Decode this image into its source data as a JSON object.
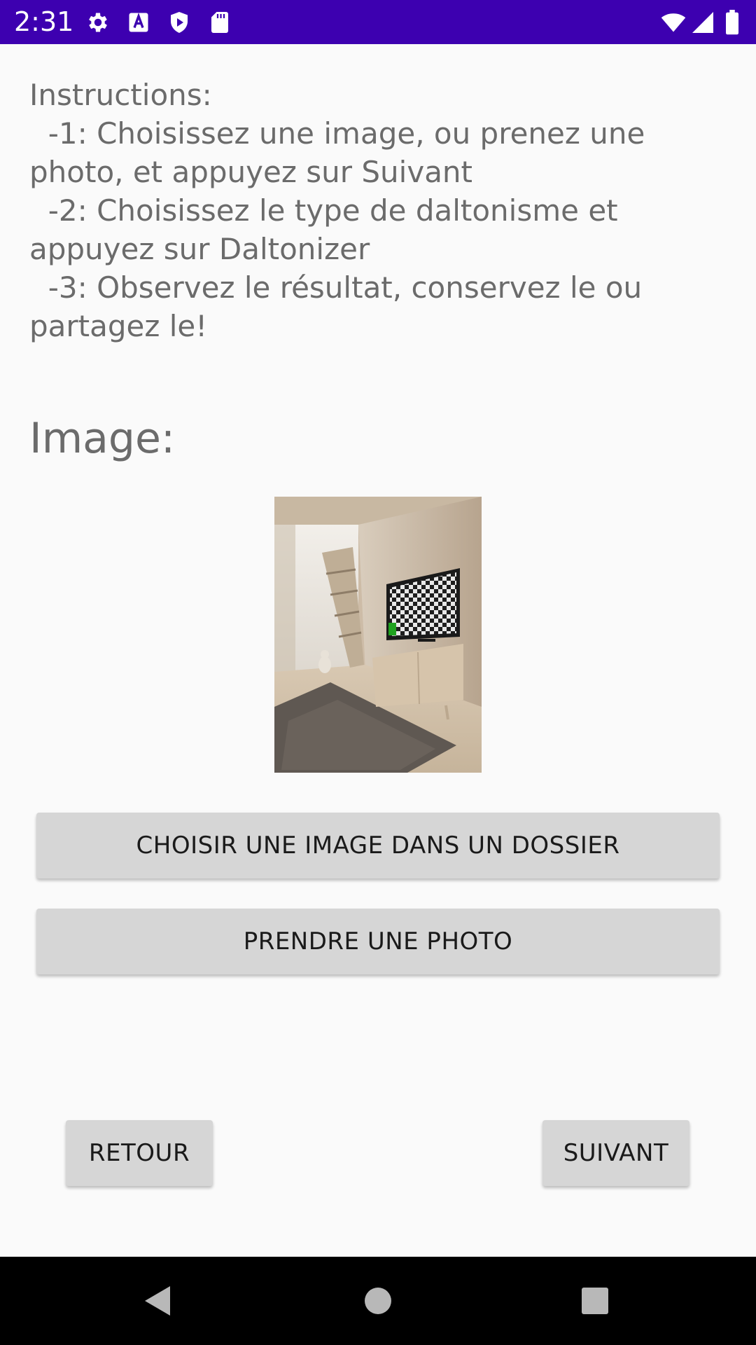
{
  "status_bar": {
    "time": "2:31",
    "icons": [
      "gear-icon",
      "text-icon",
      "shield-play-icon",
      "sd-card-icon",
      "wifi-icon",
      "signal-icon",
      "battery-icon"
    ]
  },
  "instructions": {
    "text": "Instructions:\n  -1: Choisissez une image, ou prenez une photo, et appuyez sur Suivant\n  -2: Choisissez le type de daltonisme et appuyez sur Daltonizer\n  -3: Observez le résultat, conservez le ou partagez le!"
  },
  "image_section": {
    "heading": "Image:"
  },
  "buttons": {
    "choose_folder": "CHOISIR UNE IMAGE DANS UN DOSSIER",
    "take_photo": "PRENDRE UNE PHOTO",
    "back": "RETOUR",
    "next": "SUIVANT"
  },
  "nav_bar": {
    "icons": [
      "back-triangle-icon",
      "home-circle-icon",
      "recents-square-icon"
    ]
  },
  "colors": {
    "status_bar": "#3d00b0",
    "background": "#fafafa",
    "button": "#d6d6d6",
    "text_gray": "#6b6b6b"
  }
}
